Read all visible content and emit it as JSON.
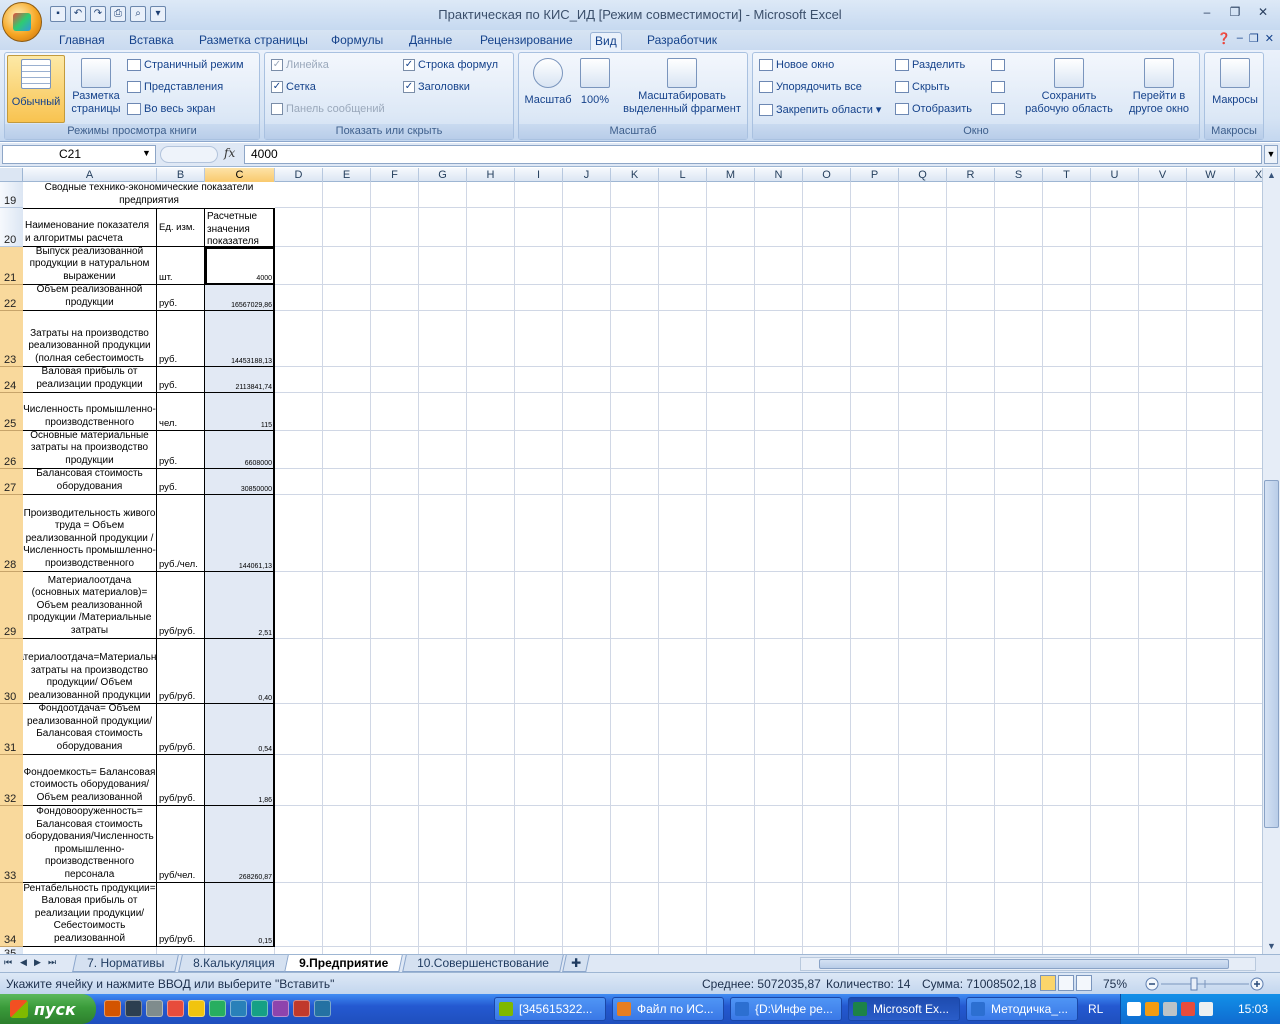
{
  "window": {
    "title": "Практическая по КИС_ИД  [Режим совместимости] - Microsoft Excel"
  },
  "ribbon_tabs": [
    "Главная",
    "Вставка",
    "Разметка страницы",
    "Формулы",
    "Данные",
    "Рецензирование",
    "Вид",
    "Разработчик"
  ],
  "active_tab": "Вид",
  "ribbon": {
    "views": {
      "normal": "Обычный",
      "page_layout_1": "Разметка",
      "page_layout_2": "страницы",
      "page_break": "Страничный режим",
      "custom_views": "Представления",
      "full_screen": "Во весь экран",
      "label": "Режимы просмотра книги"
    },
    "show": {
      "ruler": "Линейка",
      "formula_bar": "Строка формул",
      "gridlines": "Сетка",
      "headings": "Заголовки",
      "message_bar": "Панель сообщений",
      "label": "Показать или скрыть"
    },
    "zoom": {
      "zoom": "Масштаб",
      "hundred": "100%",
      "zoom_sel_1": "Масштабировать",
      "zoom_sel_2": "выделенный фрагмент",
      "label": "Масштаб"
    },
    "window": {
      "new_window": "Новое окно",
      "arrange_all": "Упорядочить все",
      "freeze": "Закрепить области",
      "split": "Разделить",
      "hide": "Скрыть",
      "unhide": "Отобразить",
      "save_ws_1": "Сохранить",
      "save_ws_2": "рабочую область",
      "switch_1": "Перейти в",
      "switch_2": "другое окно",
      "label": "Окно"
    },
    "macros": {
      "macros": "Макросы",
      "label": "Макросы"
    }
  },
  "formula_bar": {
    "name_box": "C21",
    "formula": "4000",
    "fx": "fx"
  },
  "columns": [
    "A",
    "B",
    "C",
    "D",
    "E",
    "F",
    "G",
    "H",
    "I",
    "J",
    "K",
    "L",
    "M",
    "N",
    "O",
    "P",
    "Q",
    "R",
    "S",
    "T",
    "U",
    "V",
    "W",
    "X"
  ],
  "selected_column": "C",
  "rows": [
    {
      "num": "19",
      "a": "Сводные технико-экономические показатели предприятия",
      "b": "",
      "c": ""
    },
    {
      "num": "20",
      "a": "Наименование показателя и алгоритмы расчета",
      "b": "Ед. изм.",
      "c": "Расчетные значения показателя"
    },
    {
      "num": "21",
      "a": "Выпуск реализованной продукции в натуральном выражении",
      "b": "шт.",
      "c": "4000"
    },
    {
      "num": "22",
      "a": "Объем реализованной продукции",
      "b": "руб.",
      "c": "16567029,86"
    },
    {
      "num": "23",
      "a": "Затраты на производство реализованной продукции (полная себестоимость",
      "b": "руб.",
      "c": "14453188,13"
    },
    {
      "num": "24",
      "a": "Валовая прибыль от реализации продукции",
      "b": "руб.",
      "c": "2113841,74"
    },
    {
      "num": "25",
      "a": "Численность промышленно-производственного",
      "b": "чел.",
      "c": "115"
    },
    {
      "num": "26",
      "a": "Основные материальные затраты на производство продукции",
      "b": "руб.",
      "c": "6608000"
    },
    {
      "num": "27",
      "a": "Балансовая стоимость оборудования",
      "b": "руб.",
      "c": "30850000"
    },
    {
      "num": "28",
      "a": "Производительность живого труда = Объем реализованной продукции / Численность промышленно-производственного",
      "b": "руб./чел.",
      "c": "144061,13"
    },
    {
      "num": "29",
      "a": "Материалоотдача (основных материалов)= Объем реализованной продукции /Материальные затраты",
      "b": "руб/руб.",
      "c": "2,51"
    },
    {
      "num": "30",
      "a": "Материалоотдача=Материальные затраты на производство продукции/ Объем реализованной продукции",
      "b": "руб/руб.",
      "c": "0,40"
    },
    {
      "num": "31",
      "a": "Фондоотдача= Объем реализованной продукции/Балансовая стоимость оборудования",
      "b": "руб/руб.",
      "c": "0,54"
    },
    {
      "num": "32",
      "a": "Фондоемкость= Балансовая стоимость оборудования/Объем реализованной",
      "b": "руб/руб.",
      "c": "1,86"
    },
    {
      "num": "33",
      "a": "Фондовооруженность= Балансовая стоимость оборудования/Численность промышленно-производственного персонала",
      "b": "руб/чел.",
      "c": "268260,87"
    },
    {
      "num": "34",
      "a": "Рентабельность продукции= Валовая прибыль от реализации продукции/Себестоимость реализованной",
      "b": "руб/руб.",
      "c": "0,15"
    },
    {
      "num": "35",
      "a": "",
      "b": "",
      "c": ""
    }
  ],
  "sheet_tabs": [
    "7. Нормативы",
    "8.Калькуляция",
    "9.Предприятие",
    "10.Совершенствование"
  ],
  "active_sheet": "9.Предприятие",
  "status": {
    "message": "Укажите ячейку и нажмите ВВОД или выберите \"Вставить\"",
    "average": "Среднее: 5072035,87",
    "count": "Количество: 14",
    "sum": "Сумма: 71008502,18",
    "zoom": "75%"
  },
  "taskbar": {
    "start": "пуск",
    "tasks": [
      "[345615322...",
      "Файл по ИС...",
      "{D:\\Инфе ре...",
      "Microsoft Ex...",
      "Методичка_..."
    ],
    "lang": "RL",
    "clock": "15:03"
  }
}
